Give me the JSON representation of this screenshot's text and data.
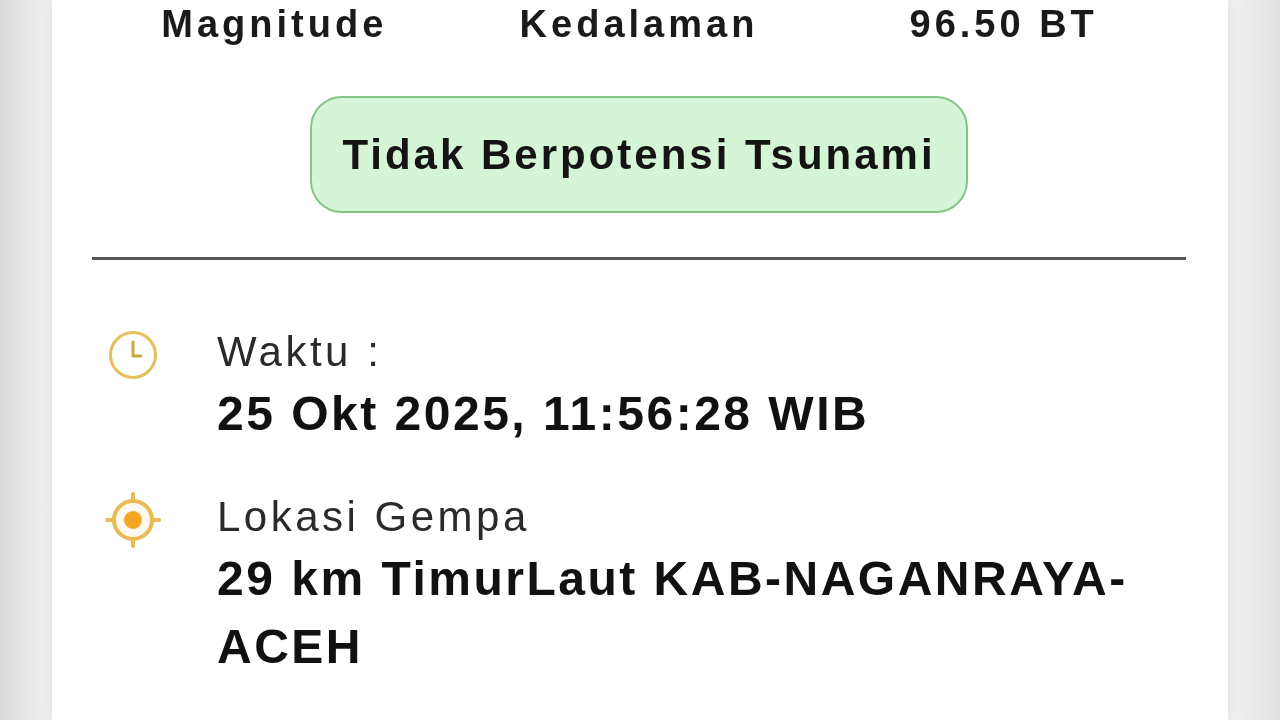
{
  "summary_row": [
    "Magnitude",
    "Kedalaman",
    "96.50 BT"
  ],
  "tsunami_status": {
    "label": "Tidak Berpotensi Tsunami"
  },
  "details": [
    {
      "kind": "time",
      "label": "Waktu :",
      "value": "25 Okt 2025, 11:56:28 WIB"
    },
    {
      "kind": "location",
      "label": "Lokasi Gempa",
      "value": "29 km TimurLaut KAB-NAGANRAYA-ACEH"
    }
  ]
}
